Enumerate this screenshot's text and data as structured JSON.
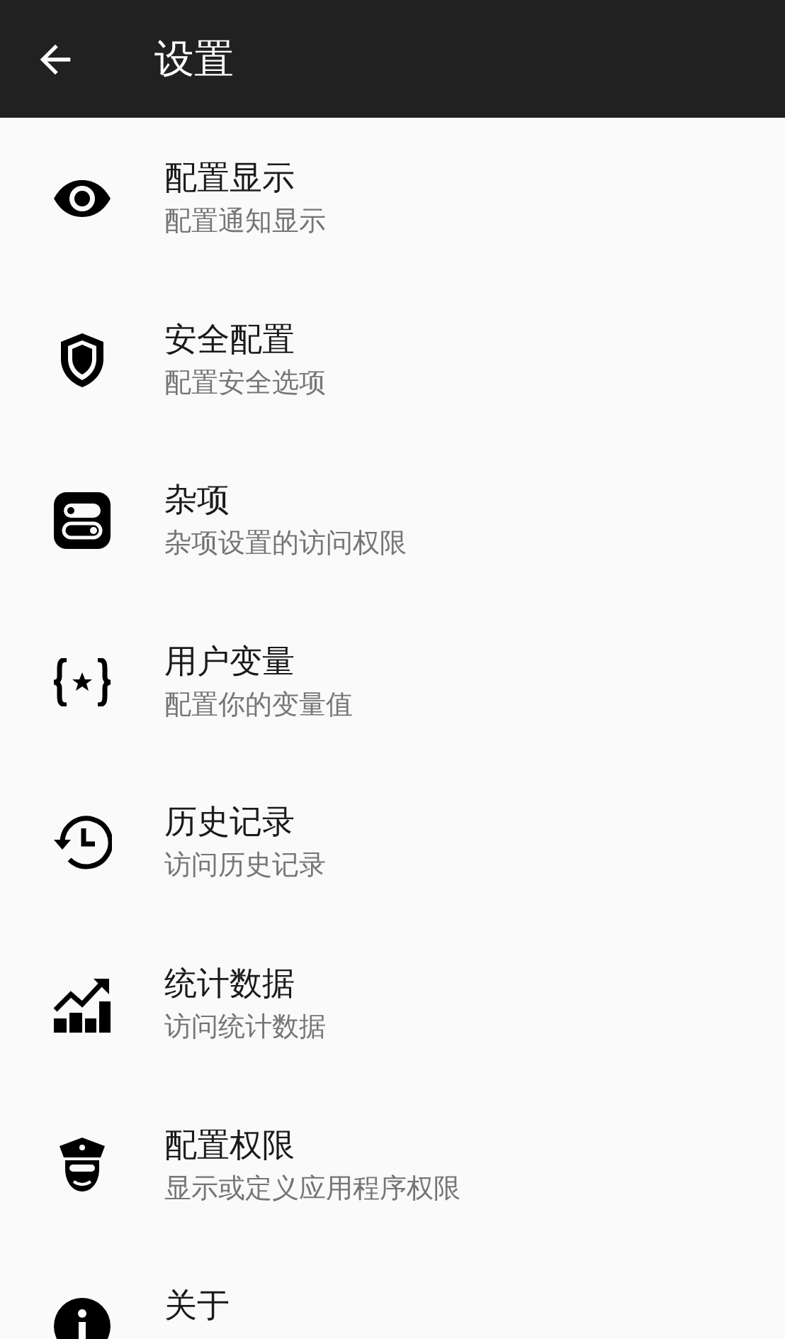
{
  "app_bar": {
    "title": "设置"
  },
  "items": [
    {
      "title": "配置显示",
      "subtitle": "配置通知显示"
    },
    {
      "title": "安全配置",
      "subtitle": "配置安全选项"
    },
    {
      "title": "杂项",
      "subtitle": "杂项设置的访问权限"
    },
    {
      "title": "用户变量",
      "subtitle": "配置你的变量值"
    },
    {
      "title": "历史记录",
      "subtitle": "访问历史记录"
    },
    {
      "title": "统计数据",
      "subtitle": "访问统计数据"
    },
    {
      "title": "配置权限",
      "subtitle": "显示或定义应用程序权限"
    },
    {
      "title": "关于"
    }
  ]
}
